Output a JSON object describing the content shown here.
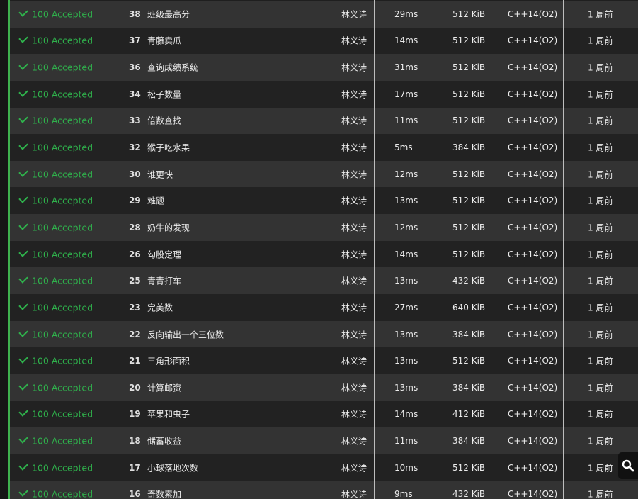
{
  "colors": {
    "accepted": "#2fb24c",
    "row_odd": "#333333",
    "row_even": "#222222",
    "accent_line": "#3fb24f"
  },
  "search": {
    "icon": "search-icon"
  },
  "records": [
    {
      "status": "100 Accepted",
      "pid": "38",
      "title": "班级最高分",
      "user": "林义诗",
      "time": "29ms",
      "memory": "512 KiB",
      "lang": "C++14(O2)",
      "ago": "1 周前"
    },
    {
      "status": "100 Accepted",
      "pid": "37",
      "title": "青藤卖瓜",
      "user": "林义诗",
      "time": "14ms",
      "memory": "512 KiB",
      "lang": "C++14(O2)",
      "ago": "1 周前"
    },
    {
      "status": "100 Accepted",
      "pid": "36",
      "title": "查询成绩系统",
      "user": "林义诗",
      "time": "31ms",
      "memory": "512 KiB",
      "lang": "C++14(O2)",
      "ago": "1 周前"
    },
    {
      "status": "100 Accepted",
      "pid": "34",
      "title": "松子数量",
      "user": "林义诗",
      "time": "17ms",
      "memory": "512 KiB",
      "lang": "C++14(O2)",
      "ago": "1 周前"
    },
    {
      "status": "100 Accepted",
      "pid": "33",
      "title": "倍数查找",
      "user": "林义诗",
      "time": "11ms",
      "memory": "512 KiB",
      "lang": "C++14(O2)",
      "ago": "1 周前"
    },
    {
      "status": "100 Accepted",
      "pid": "32",
      "title": "猴子吃水果",
      "user": "林义诗",
      "time": "5ms",
      "memory": "384 KiB",
      "lang": "C++14(O2)",
      "ago": "1 周前"
    },
    {
      "status": "100 Accepted",
      "pid": "30",
      "title": "谁更快",
      "user": "林义诗",
      "time": "12ms",
      "memory": "512 KiB",
      "lang": "C++14(O2)",
      "ago": "1 周前"
    },
    {
      "status": "100 Accepted",
      "pid": "29",
      "title": "难题",
      "user": "林义诗",
      "time": "13ms",
      "memory": "512 KiB",
      "lang": "C++14(O2)",
      "ago": "1 周前"
    },
    {
      "status": "100 Accepted",
      "pid": "28",
      "title": "奶牛的发现",
      "user": "林义诗",
      "time": "12ms",
      "memory": "512 KiB",
      "lang": "C++14(O2)",
      "ago": "1 周前"
    },
    {
      "status": "100 Accepted",
      "pid": "26",
      "title": "勾股定理",
      "user": "林义诗",
      "time": "14ms",
      "memory": "512 KiB",
      "lang": "C++14(O2)",
      "ago": "1 周前"
    },
    {
      "status": "100 Accepted",
      "pid": "25",
      "title": "青青打车",
      "user": "林义诗",
      "time": "13ms",
      "memory": "432 KiB",
      "lang": "C++14(O2)",
      "ago": "1 周前"
    },
    {
      "status": "100 Accepted",
      "pid": "23",
      "title": "完美数",
      "user": "林义诗",
      "time": "27ms",
      "memory": "640 KiB",
      "lang": "C++14(O2)",
      "ago": "1 周前"
    },
    {
      "status": "100 Accepted",
      "pid": "22",
      "title": "反向输出一个三位数",
      "user": "林义诗",
      "time": "13ms",
      "memory": "384 KiB",
      "lang": "C++14(O2)",
      "ago": "1 周前"
    },
    {
      "status": "100 Accepted",
      "pid": "21",
      "title": "三角形面积",
      "user": "林义诗",
      "time": "13ms",
      "memory": "512 KiB",
      "lang": "C++14(O2)",
      "ago": "1 周前"
    },
    {
      "status": "100 Accepted",
      "pid": "20",
      "title": "计算邮资",
      "user": "林义诗",
      "time": "13ms",
      "memory": "384 KiB",
      "lang": "C++14(O2)",
      "ago": "1 周前"
    },
    {
      "status": "100 Accepted",
      "pid": "19",
      "title": "苹果和虫子",
      "user": "林义诗",
      "time": "14ms",
      "memory": "412 KiB",
      "lang": "C++14(O2)",
      "ago": "1 周前"
    },
    {
      "status": "100 Accepted",
      "pid": "18",
      "title": "储蓄收益",
      "user": "林义诗",
      "time": "11ms",
      "memory": "384 KiB",
      "lang": "C++14(O2)",
      "ago": "1 周前"
    },
    {
      "status": "100 Accepted",
      "pid": "17",
      "title": "小球落地次数",
      "user": "林义诗",
      "time": "10ms",
      "memory": "512 KiB",
      "lang": "C++14(O2)",
      "ago": "1 周前"
    },
    {
      "status": "100 Accepted",
      "pid": "16",
      "title": "奇数累加",
      "user": "林义诗",
      "time": "9ms",
      "memory": "432 KiB",
      "lang": "C++14(O2)",
      "ago": "1 周前"
    }
  ]
}
